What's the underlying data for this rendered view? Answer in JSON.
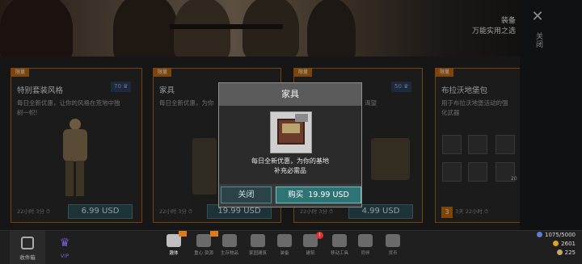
{
  "banner": {
    "title": "装备",
    "subtitle": "万能实用之选"
  },
  "close": {
    "label": "关闭"
  },
  "cards": [
    {
      "tag": "限量",
      "name": "特别套装风格",
      "badge": "70",
      "desc_line1": "每日全新优惠，让你的风格在荒地中独",
      "desc_line2": "树一帜!",
      "timer": "22小时 3分",
      "price": "6.99 USD"
    },
    {
      "tag": "限量",
      "name": "家具",
      "desc_line1": "每日全新优惠，为你",
      "timer": "22小时 3分",
      "price": "19.99 USD"
    },
    {
      "tag": "限量",
      "badge": "50",
      "desc_line1": "渴望",
      "timer": "22小时 3分",
      "price": "4.99 USD"
    },
    {
      "tag": "限量",
      "name": "布拉沃地堡包",
      "desc_line1": "用于布拉沃地堡活动的强",
      "desc_line2": "化武器",
      "timer": "3天 22小时",
      "count": "3",
      "item_qty": "20"
    }
  ],
  "dialog": {
    "title": "家具",
    "desc_line1": "每日全新优惠，为你的基地",
    "desc_line2": "补充必需品",
    "close_label": "关闭",
    "buy_label": "购买",
    "buy_price": "19.99 USD"
  },
  "bottom_tabs": [
    {
      "label": "收件箱",
      "icon": "inbox-icon"
    },
    {
      "label": "VIP",
      "icon": "crown-icon"
    }
  ],
  "bottom_nav": [
    {
      "label": "趣体",
      "icon": "thumbs-up-icon"
    },
    {
      "label": "重心 资源",
      "icon": "gear-icon"
    },
    {
      "label": "生存物品",
      "icon": "fire-icon"
    },
    {
      "label": "家园建筑",
      "icon": "building-icon"
    },
    {
      "label": "装备",
      "icon": "gun-icon"
    },
    {
      "label": "建筑",
      "icon": "tools-icon"
    },
    {
      "label": "移动工具",
      "icon": "motorbike-icon"
    },
    {
      "label": "同伴",
      "icon": "dog-icon"
    },
    {
      "label": "货币",
      "icon": "money-icon"
    }
  ],
  "resources": {
    "capacity": "1075/5000",
    "gold": "2601",
    "gems": "225"
  },
  "colors": {
    "accent_orange": "#c26a10",
    "teal_button": "#2e7474",
    "vip_purple": "#7b5fd6"
  }
}
